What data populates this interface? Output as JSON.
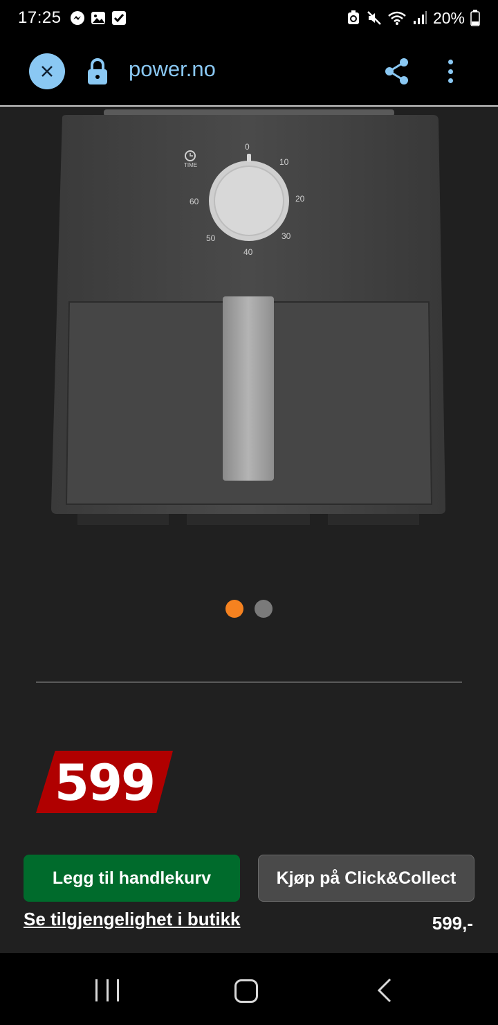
{
  "status_bar": {
    "time": "17:25",
    "battery": "20%",
    "left_icons": [
      "messenger-icon",
      "gallery-icon",
      "checkbox-icon"
    ],
    "right_icons": [
      "recycle-icon",
      "mute-icon",
      "wifi-icon",
      "signal-icon",
      "battery-icon"
    ]
  },
  "browser": {
    "url": "power.no",
    "icons": [
      "close-icon",
      "lock-icon",
      "share-icon",
      "more-icon"
    ]
  },
  "product": {
    "image_icon": "air-fryer-image",
    "dial": {
      "label": "TIME",
      "marks": [
        "0",
        "10",
        "20",
        "30",
        "40",
        "50",
        "60"
      ]
    },
    "carousel": {
      "count": 2,
      "active_index": 0
    }
  },
  "price": {
    "badge": "599",
    "summary": "599,-"
  },
  "actions": {
    "add_to_cart": "Legg til handlekurv",
    "click_collect": "Kjøp på Click&Collect",
    "availability": "Se tilgjengelighet i butikk"
  },
  "colors": {
    "background": "#202020",
    "accent": "#8ac8f3",
    "cart_button": "#006b2c",
    "collect_button": "#4a4a4a",
    "price_badge": "#b00000",
    "active_dot": "#f58220"
  }
}
